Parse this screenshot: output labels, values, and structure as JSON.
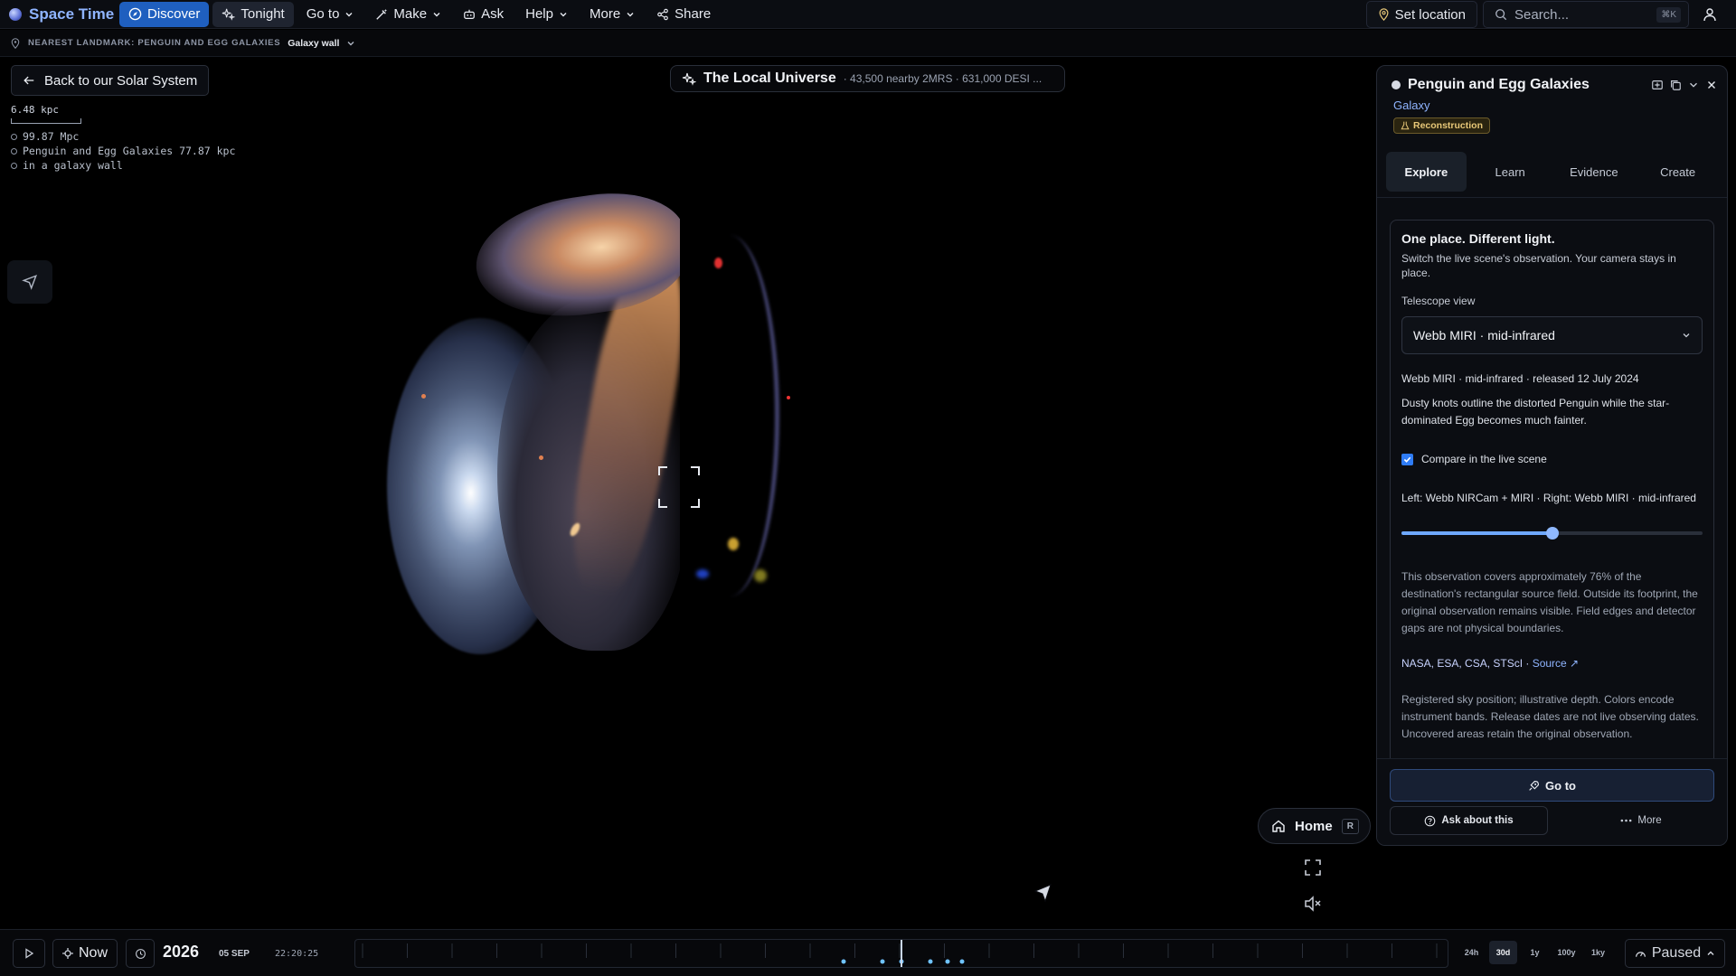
{
  "app": {
    "name": "Space Time"
  },
  "nav": {
    "discover": "Discover",
    "tonight": "Tonight",
    "goto": "Go to",
    "make": "Make",
    "ask": "Ask",
    "help": "Help",
    "more": "More",
    "share": "Share"
  },
  "topright": {
    "set_location": "Set location",
    "search_placeholder": "Search...",
    "search_shortcut": "⌘K"
  },
  "landmark": {
    "label": "NEAREST LANDMARK: PENGUIN AND EGG GALAXIES",
    "value": "Galaxy wall"
  },
  "hud": {
    "back": "Back to our Solar System",
    "scale": "6.48 kpc",
    "readouts": [
      "99.87 Mpc",
      "Penguin and Egg Galaxies 77.87 kpc",
      "in a galaxy wall"
    ]
  },
  "scene": {
    "title": "The Local Universe",
    "subtitle": "· 43,500 nearby 2MRS · 631,000 DESI ..."
  },
  "controls": {
    "home": "Home",
    "home_key": "R"
  },
  "panel": {
    "title": "Penguin and Egg Galaxies",
    "type": "Galaxy",
    "badge": "Reconstruction",
    "tabs": [
      "Explore",
      "Learn",
      "Evidence",
      "Create"
    ],
    "active_tab": 0,
    "card": {
      "heading": "One place. Different light.",
      "intro": "Switch the live scene's observation. Your camera stays in place.",
      "telescope_label": "Telescope view",
      "telescope_value": "Webb MIRI · mid-infrared",
      "info": "Webb MIRI · mid-infrared · released 12 July 2024",
      "desc": "Dusty knots outline the distorted Penguin while the star-dominated Egg becomes much fainter.",
      "compare_label": "Compare in the live scene",
      "compare_checked": true,
      "compare_desc": "Left: Webb NIRCam + MIRI · Right: Webb MIRI · mid-infrared",
      "slider_value": 0.5,
      "coverage": "This observation covers approximately 76% of the destination's rectangular source field. Outside its footprint, the original observation remains visible. Field edges and detector gaps are not physical boundaries.",
      "credit": "NASA, ESA, CSA, STScI · ",
      "source": "Source ↗",
      "note": "Registered sky position; illustrative depth. Colors encode instrument bands. Release dates are not live observing dates. Uncovered areas retain the original observation."
    },
    "footer": {
      "goto": "Go to",
      "ask": "Ask about this",
      "more": "More"
    }
  },
  "timeline": {
    "now": "Now",
    "year": "2026",
    "date": "05 SEP",
    "time": "22:20:25",
    "ranges": [
      "24h",
      "30d",
      "1y",
      "100y",
      "1ky"
    ],
    "active_range": 1,
    "state": "Paused"
  },
  "colors": {
    "accent": "#1f5fbf",
    "link": "#8fb4ff",
    "badge": "#e8c878"
  }
}
